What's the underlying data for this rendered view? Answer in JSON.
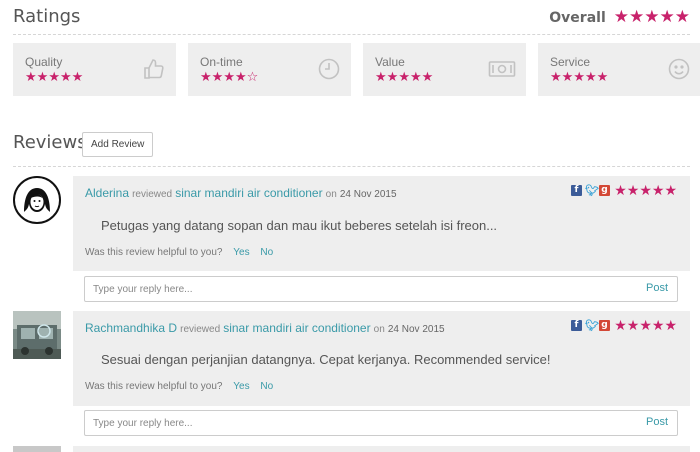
{
  "ratings": {
    "title": "Ratings",
    "overall_label": "Overall",
    "overall_stars": 5,
    "accent_color": "#c8226b",
    "categories": [
      {
        "label": "Quality",
        "stars": 5,
        "icon": "thumbs-up-icon"
      },
      {
        "label": "On-time",
        "stars": 4,
        "icon": "clock-icon"
      },
      {
        "label": "Value",
        "stars": 5,
        "icon": "money-icon"
      },
      {
        "label": "Service",
        "stars": 5,
        "icon": "smiley-icon"
      }
    ]
  },
  "reviews": {
    "title": "Reviews",
    "add_review_label": "Add Review",
    "reviewed_word": "reviewed",
    "on_word": "on",
    "helpful_question": "Was this review helpful to you?",
    "yes_label": "Yes",
    "no_label": "No",
    "reply_placeholder": "Type your reply here...",
    "post_label": "Post",
    "items": [
      {
        "reviewer": "Alderina",
        "product": "sinar mandiri air conditioner",
        "date": "24 Nov 2015",
        "text": "Petugas yang datang sopan dan mau ikut beberes setelah isi freon...",
        "stars": 5
      },
      {
        "reviewer": "Rachmandhika D",
        "product": "sinar mandiri air conditioner",
        "date": "24 Nov 2015",
        "text": "Sesuai dengan perjanjian datangnya. Cepat kerjanya. Recommended service!",
        "stars": 5
      }
    ]
  }
}
